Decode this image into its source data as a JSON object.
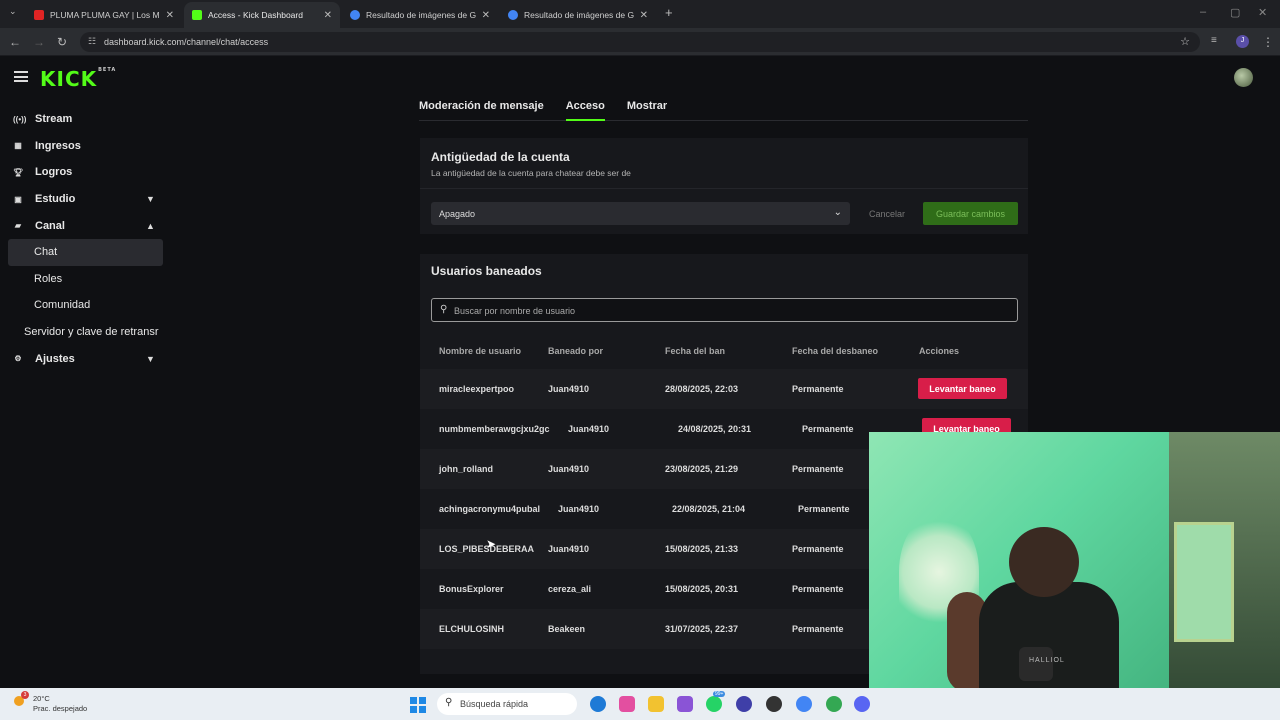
{
  "browser": {
    "tabs": [
      {
        "title": "PLUMA PLUMA GAY | Los Morr",
        "favicon_color": "#e02424"
      },
      {
        "title": "Access - Kick Dashboard",
        "favicon_color": "#53fc18"
      },
      {
        "title": "Resultado de imágenes de Goo",
        "favicon_color": "#4285f4"
      },
      {
        "title": "Resultado de imágenes de Goo",
        "favicon_color": "#4285f4"
      }
    ],
    "url": "dashboard.kick.com/channel/chat/access",
    "profile_initial": "J"
  },
  "app": {
    "logo": "KICK",
    "logo_badge": "BETA",
    "accent_color": "#53fc18"
  },
  "sidebar": {
    "items": [
      {
        "label": "Stream",
        "icon": "broadcast-icon"
      },
      {
        "label": "Ingresos",
        "icon": "chart-icon"
      },
      {
        "label": "Logros",
        "icon": "trophy-icon"
      },
      {
        "label": "Estudio",
        "icon": "studio-icon",
        "chevron": "down"
      },
      {
        "label": "Canal",
        "icon": "channel-icon",
        "chevron": "up"
      },
      {
        "label": "Chat",
        "sub": true,
        "active": true
      },
      {
        "label": "Roles",
        "sub": true
      },
      {
        "label": "Comunidad",
        "sub": true
      },
      {
        "label": "Servidor y clave de retransr",
        "plain": true
      },
      {
        "label": "Ajustes",
        "icon": "gear-icon",
        "chevron": "down"
      }
    ]
  },
  "main": {
    "tabs": [
      {
        "label": "Moderación de mensaje"
      },
      {
        "label": "Acceso",
        "active": true
      },
      {
        "label": "Mostrar"
      }
    ],
    "account_age": {
      "title": "Antigüedad de la cuenta",
      "description": "La antigüedad de la cuenta para chatear debe ser de",
      "selected": "Apagado",
      "cancel_label": "Cancelar",
      "save_label": "Guardar cambios"
    },
    "banned": {
      "title": "Usuarios baneados",
      "search_placeholder": "Buscar por nombre de usuario",
      "columns": [
        "Nombre de usuario",
        "Baneado por",
        "Fecha del ban",
        "Fecha del desbaneo",
        "Acciones"
      ],
      "rows": [
        {
          "user": "miracleexpertpoo",
          "by": "Juan4910",
          "date": "28/08/2025, 22:03",
          "unban": "Permanente",
          "action": "Levantar baneo"
        },
        {
          "user": "numbmemberawgcjxu2gc",
          "by": "Juan4910",
          "date": "24/08/2025, 20:31",
          "unban": "Permanente",
          "action": "Levantar baneo"
        },
        {
          "user": "john_rolland",
          "by": "Juan4910",
          "date": "23/08/2025, 21:29",
          "unban": "Permanente"
        },
        {
          "user": "achingacronymu4pubal",
          "by": "Juan4910",
          "date": "22/08/2025, 21:04",
          "unban": "Permanente"
        },
        {
          "user": "LOS_PIBESDEBERAA",
          "by": "Juan4910",
          "date": "15/08/2025, 21:33",
          "unban": "Permanente"
        },
        {
          "user": "BonusExplorer",
          "by": "cereza_ali",
          "date": "15/08/2025, 20:31",
          "unban": "Permanente"
        },
        {
          "user": "ELCHULOSINH",
          "by": "Beakeen",
          "date": "31/07/2025, 22:37",
          "unban": "Permanente"
        }
      ]
    }
  },
  "webcam": {
    "shirt_text": "HALLIOL"
  },
  "taskbar": {
    "weather_temp": "20°C",
    "weather_desc": "Prac. despejado",
    "weather_badge": "3",
    "search_placeholder": "Búsqueda rápida",
    "notif_badge": "99+"
  }
}
